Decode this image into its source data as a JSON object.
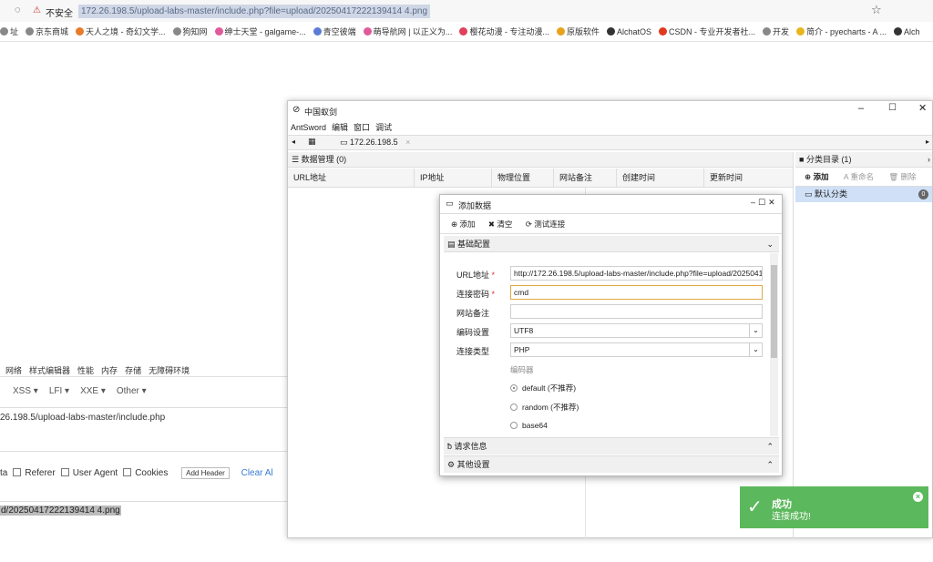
{
  "browser": {
    "security_label": "不安全",
    "url": "172.26.198.5/upload-labs-master/include.php?file=upload/20250417222139414 4.png",
    "bookmarks": [
      {
        "label": "址",
        "color": "#888"
      },
      {
        "label": "京东商城",
        "color": "#888"
      },
      {
        "label": "天人之境 - 奇幻文学...",
        "color": "#e77b2a"
      },
      {
        "label": "狗知网",
        "color": "#888"
      },
      {
        "label": "绅士天堂 - galgame-...",
        "color": "#e05a9b"
      },
      {
        "label": "青空彼端",
        "color": "#5b7bd6"
      },
      {
        "label": "萌导航网 | 以正义为...",
        "color": "#e05a9b"
      },
      {
        "label": "樱花动漫 - 专注动漫...",
        "color": "#e0405a"
      },
      {
        "label": "原版软件",
        "color": "#e8a21c"
      },
      {
        "label": "AlchatOS",
        "color": "#333"
      },
      {
        "label": "CSDN - 专业开发者社...",
        "color": "#e03a1e"
      },
      {
        "label": "开发",
        "color": "#888"
      },
      {
        "label": "简介 - pyecharts - A ...",
        "color": "#e8b51c"
      },
      {
        "label": "Alch",
        "color": "#333"
      }
    ]
  },
  "devtools": {
    "tabs": [
      "网络",
      "样式编辑器",
      "性能",
      "内存",
      "存储",
      "无障碍环境"
    ],
    "menus": [
      "XSS ▾",
      "LFI ▾",
      "XXE ▾",
      "Other ▾"
    ],
    "url_line": "26.198.5/upload-labs-master/include.php",
    "checks": [
      "ta",
      "Referer",
      "User Agent",
      "Cookies"
    ],
    "add_header": "Add Header",
    "clear": "Clear Al",
    "post_line": "d/20250417222139414 4.png"
  },
  "antsword": {
    "title": "中国蚁剑",
    "menu": [
      "AntSword",
      "编辑",
      "窗口",
      "调试"
    ],
    "tab_label": "172.26.198.5",
    "data_header": "数据管理 (0)",
    "columns": [
      "URL地址",
      "IP地址",
      "物理位置",
      "网站备注",
      "创建时间",
      "更新时间"
    ],
    "category_header": "分类目录 (1)",
    "cat_buttons": [
      "添加",
      "重命名",
      "删除"
    ],
    "category_item": "默认分类",
    "category_count": "0"
  },
  "dialog": {
    "title": "添加数据",
    "toolbar": [
      "添加",
      "清空",
      "测试连接"
    ],
    "section_basic": "基础配置",
    "fields": {
      "url_label": "URL地址",
      "url_value": "http://172.26.198.5/upload-labs-master/include.php?file=upload/2025041",
      "pwd_label": "连接密码",
      "pwd_value": "cmd",
      "note_label": "网站备注",
      "note_value": "",
      "enc_label": "编码设置",
      "enc_value": "UTF8",
      "type_label": "连接类型",
      "type_value": "PHP"
    },
    "encoder_label": "编码器",
    "encoders": [
      {
        "label": "default (不推荐)",
        "checked": true
      },
      {
        "label": "random (不推荐)",
        "checked": false
      },
      {
        "label": "base64",
        "checked": false
      }
    ],
    "section_request": "请求信息",
    "section_other": "其他设置"
  },
  "toast": {
    "title": "成功",
    "message": "连接成功!"
  }
}
